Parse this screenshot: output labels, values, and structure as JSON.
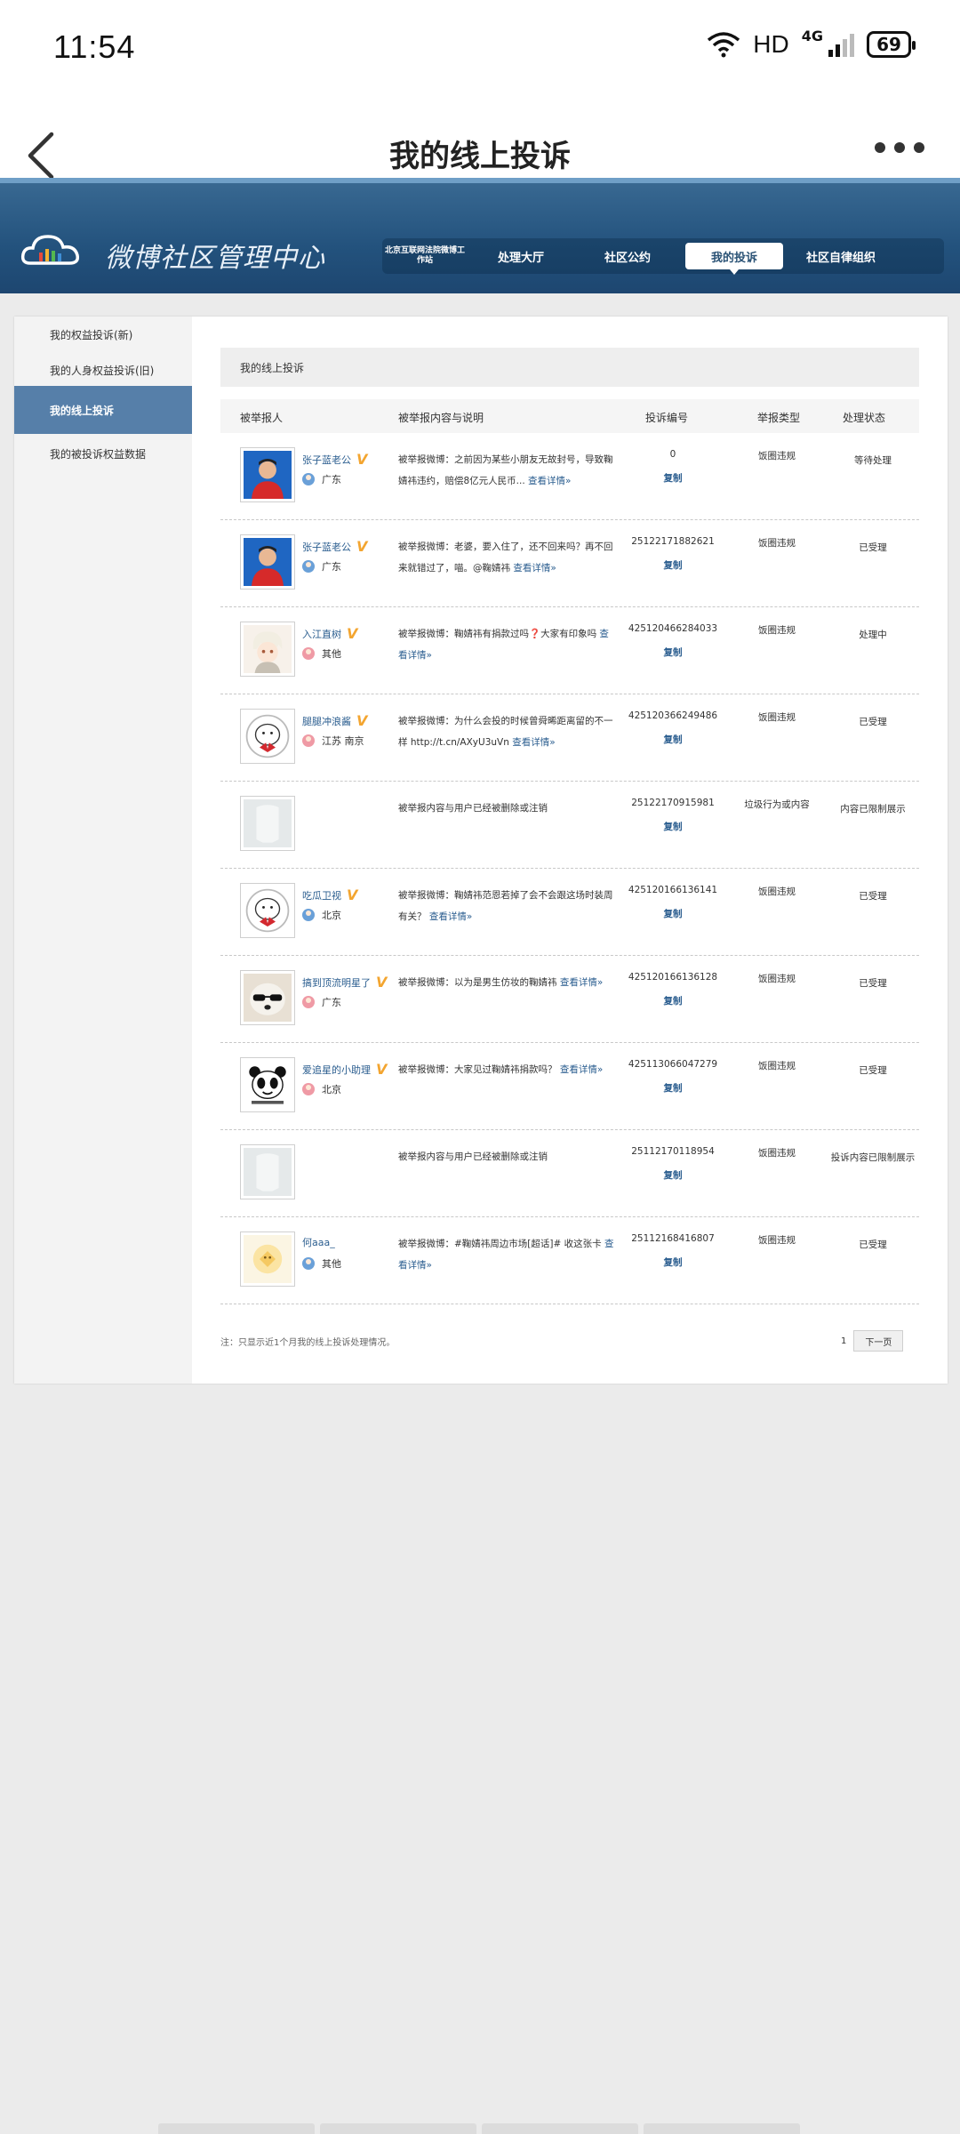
{
  "status_bar": {
    "time": "11:54",
    "hd": "HD",
    "network": "4G",
    "battery": "69"
  },
  "nav": {
    "title": "我的线上投诉"
  },
  "weibo_header": {
    "brand": "微博社区管理中心",
    "topnav": [
      {
        "label": "北京互联网法院微博工作站"
      },
      {
        "label": "处理大厅"
      },
      {
        "label": "社区公约"
      },
      {
        "label": "我的投诉",
        "active": true
      },
      {
        "label": "社区自律组织"
      }
    ]
  },
  "sidebar": {
    "items": [
      {
        "label": "我的权益投诉(新)"
      },
      {
        "label": "我的人身权益投诉(旧)"
      },
      {
        "label": "我的线上投诉",
        "active": true
      },
      {
        "label": "我的被投诉权益数据"
      }
    ]
  },
  "main": {
    "section_title": "我的线上投诉",
    "columns": [
      "被举报人",
      "被举报内容与说明",
      "投诉编号",
      "举报类型",
      "处理状态"
    ],
    "copy_label": "复制",
    "rows": [
      {
        "name": "张子蓝老公",
        "verified": true,
        "location": "广东",
        "gender": "male",
        "avatar": "red-shirt",
        "desc": "被举报微博：之前因为某些小朋友无故封号，导致鞠婧祎违约，赔偿8亿元人民币...",
        "link": "查看详情»",
        "id": "0",
        "type": "饭圈违规",
        "status": "等待处理"
      },
      {
        "name": "张子蓝老公",
        "verified": true,
        "location": "广东",
        "gender": "male",
        "avatar": "red-shirt",
        "desc": "被举报微博：老婆，要入住了，还不回来吗？再不回来就错过了，喵。@鞠婧祎",
        "link": "查看详情»",
        "id": "25122171882621",
        "type": "饭圈违规",
        "status": "已受理"
      },
      {
        "name": "入江直树",
        "verified": true,
        "location": "其他",
        "gender": "female",
        "avatar": "anime",
        "desc": "被举报微博：鞠婧祎有捐款过吗❓大家有印象吗",
        "link": "查看详情»",
        "id": "425120466284033",
        "type": "饭圈违规",
        "status": "处理中"
      },
      {
        "name": "腿腿冲浪酱",
        "verified": true,
        "location": "江苏 南京",
        "gender": "female",
        "avatar": "cartoon",
        "desc": "被举报微博：为什么会投的时候曾舜晞距离留的不一样 http://t.cn/AXyU3uVn",
        "link": "查看详情»",
        "id": "425120366249486",
        "type": "饭圈违规",
        "status": "已受理"
      },
      {
        "name": "",
        "verified": false,
        "location": "",
        "gender": "",
        "avatar": "blank",
        "desc": "被举报内容与用户已经被删除或注销",
        "link": "",
        "id": "25122170915981",
        "type": "垃圾行为或内容",
        "status": "内容已限制展示"
      },
      {
        "name": "吃瓜卫视",
        "verified": true,
        "location": "北京",
        "gender": "male",
        "avatar": "cartoon",
        "desc": "被举报微博：鞠婧祎范恩若掉了会不会跟这场时装周有关？",
        "link": "查看详情»",
        "id": "425120166136141",
        "type": "饭圈违规",
        "status": "已受理"
      },
      {
        "name": "搞到顶流明星了",
        "verified": true,
        "location": "广东",
        "gender": "female",
        "avatar": "dog",
        "desc": "被举报微博：以为是男生仿妆的鞠婧祎",
        "link": "查看详情»",
        "id": "425120166136128",
        "type": "饭圈违规",
        "status": "已受理"
      },
      {
        "name": "爱追星的小助理",
        "verified": true,
        "location": "北京",
        "gender": "female",
        "avatar": "panda",
        "desc": "被举报微博：大家见过鞠婧祎捐款吗？",
        "link": "查看详情»",
        "id": "425113066047279",
        "type": "饭圈违规",
        "status": "已受理"
      },
      {
        "name": "",
        "verified": false,
        "location": "",
        "gender": "",
        "avatar": "blank",
        "desc": "被举报内容与用户已经被删除或注销",
        "link": "",
        "id": "25112170118954",
        "type": "饭圈违规",
        "status": "投诉内容已限制展示"
      },
      {
        "name": "何aaa_",
        "verified": false,
        "location": "其他",
        "gender": "male",
        "avatar": "yellow",
        "desc": "被举报微博：#鞠婧祎周边市场[超话]# 收这张卡",
        "link": "查看详情»",
        "id": "25112168416807",
        "type": "饭圈违规",
        "status": "已受理"
      }
    ],
    "footer_note": "注：只显示近1个月我的线上投诉处理情况。",
    "pager": {
      "current": "1",
      "next_label": "下一页"
    }
  }
}
